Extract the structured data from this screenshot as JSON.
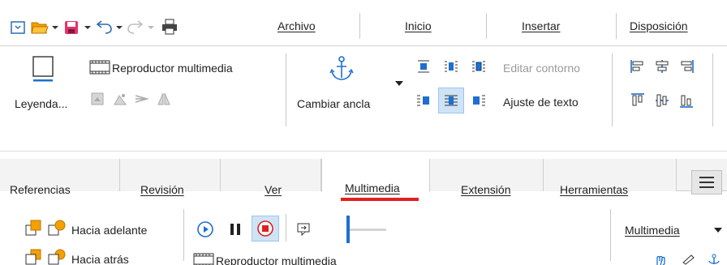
{
  "top": {
    "menu_tabs": [
      "Archivo",
      "Inicio",
      "Insertar",
      "Disposición"
    ],
    "caption_label": "Leyenda...",
    "media_player_label": "Reproductor multimedia",
    "anchor_label": "Cambiar ancla",
    "edit_contour_label": "Editar contorno",
    "wrap_text_label": "Ajuste de texto"
  },
  "bottom": {
    "tabs": [
      "Referencias",
      "Revisión",
      "Ver",
      "Multimedia",
      "Extensión",
      "Herramientas"
    ],
    "active_tab": "Multimedia",
    "bring_forward_label": "Hacia adelante",
    "send_backward_label": "Hacia atrás",
    "media_player_label": "Reproductor multimedia",
    "multimedia_dropdown_label": "Multimedia"
  },
  "colors": {
    "accent_blue": "#1e6fcf",
    "active_tab_underline": "#e02020",
    "icon_orange": "#f5a000"
  }
}
